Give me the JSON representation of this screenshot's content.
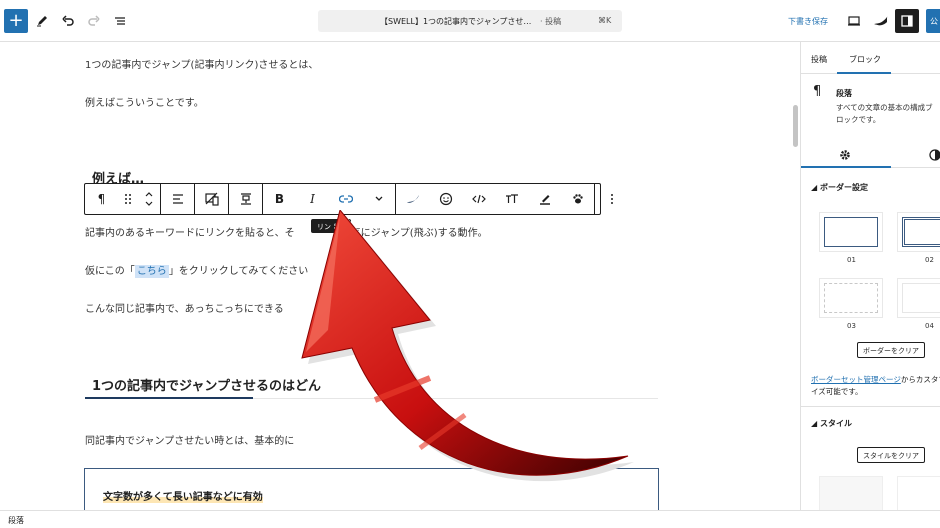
{
  "topbar": {
    "plus": "+",
    "doc_title": "【SWELL】1つの記事内でジャンプさせ…",
    "doc_type": "· 投稿",
    "shortcut": "⌘K",
    "save_draft": "下書き保存",
    "publish": "公"
  },
  "content": {
    "p1": "1つの記事内でジャンプ(記事内リンク)させるとは、",
    "p2": "例えばこういうことです。",
    "h3": "例えば…",
    "p3": "記事内のあるキーワードにリンクを貼ると、そ",
    "p3b": "一気にジャンプ(飛ぶ)する動作。",
    "p4_pre": "仮にこの「",
    "p4_link": "こちら",
    "p4_post": "」をクリックしてみてください",
    "p5": "こんな同じ記事内で、あっちこっちにできる",
    "h2": "1つの記事内でジャンプさせるのはどん",
    "p6": "同記事内でジャンプさせたい時とは、基本的に",
    "box_title": "文字数が多くて長い記事などに有効"
  },
  "tooltip": "リン ⌘K",
  "sidebar": {
    "tab_post": "投稿",
    "tab_block": "ブロック",
    "block_title": "段落",
    "block_desc": "すべての文章の基本の構成ブロックです。",
    "border_title": "ボーダー設定",
    "borders": [
      "01",
      "02",
      "03",
      "04"
    ],
    "clear_border": "ボーダーをクリア",
    "link_text": "ボーダーセット管理ページ",
    "link_suffix": "からカスタマイズ可能です。",
    "style_title": "スタイル",
    "clear_style": "スタイルをクリア"
  },
  "footer": {
    "breadcrumb": "段落"
  },
  "colors": {
    "accent": "#2271b1",
    "arrow": "#d21414"
  }
}
